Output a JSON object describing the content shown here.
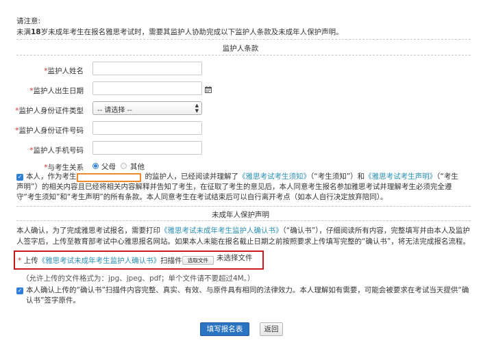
{
  "notice": {
    "title": "请注意:",
    "body_prefix": "未满",
    "body_age": "18",
    "body_suffix": "岁未成年考生在报名雅思考试时，需要其监护人协助完成以下监护人条款及未成年人保护声明。"
  },
  "guardian_section": {
    "title": "监护人条款",
    "fields": {
      "name": {
        "required": "*",
        "label": "监护人姓名",
        "value": ""
      },
      "birthdate": {
        "required": "*",
        "label": "监护人出生日期",
        "value": "",
        "icon": "calendar-icon"
      },
      "id_type": {
        "required": "*",
        "label": "监护人身份证件类型",
        "selected": "-- 请选择 --"
      },
      "id_number": {
        "required": "*",
        "label": "监护人身份证件号码",
        "value": ""
      },
      "phone": {
        "required": "*",
        "label": "监护人手机号码",
        "value": ""
      }
    },
    "relation": {
      "required": "*",
      "label": "与考生关系",
      "options": [
        "父母",
        "其他"
      ],
      "selected": "父母"
    },
    "agreement": {
      "line1_a": "本人，作为考生",
      "line1_b": "的监护人，已经阅读并理解了",
      "link1": "《雅思考试考生须知》",
      "line1_c": "（“考生须知”）和",
      "link2": "《雅思考试考生声明》",
      "line1_d": "（“考生",
      "line2": "声明”）的相关内容且已经将相关内容解释并告知了考生，在征取了考生的意见后，本人同意考生报名参加雅思考试并理解考生必须完全遵",
      "line3": "守“考生须知”和“考生声明”的所有条款。本人同意考生在考试结束后可以自行离开考点（如本人自行决定放弃陪同）。"
    }
  },
  "minor_section": {
    "title": "未成年人保护声明",
    "para_line1_a": "本人确认，为了完成雅思考试报名，需要打印",
    "para_link": "《雅思考试未成年考生监护人确认书》",
    "para_line1_b": "（“确认书”），仔细阅读所有内容，完整填写并由本人及监护",
    "para_line2": "人签字后，上传至教育部考试中心雅思报名网站。如果本人未能在报名截止日期之前按照要求上传填写完整的“确认书”，将无法完成报名流程。",
    "upload": {
      "required": "*",
      "prefix": "上传",
      "link": "《雅思考试未成年考生监护人确认书》",
      "suffix": "扫描件",
      "button": "选取文件",
      "status": "未选择文件"
    },
    "formats_note": "（允许上传的文件格式为：jpg、jpeg、pdf；单个文件请不要超过4M。）",
    "confirm_line1": "本人确认上传的“确认书”扫描件内容完整、真实、有效、与原件具有相同的法律效力。本人理解如有需要，可能会被要求在考试当天提供“确",
    "confirm_line2": "认书”签字原件。"
  },
  "buttons": {
    "submit": "填写报名表",
    "back": "返回"
  },
  "colors": {
    "required": "#d2322d",
    "link": "#2a8fb5",
    "primary_button": "#2a73c2",
    "highlight_orange": "#ef8a2c",
    "highlight_red": "#c8191d"
  }
}
